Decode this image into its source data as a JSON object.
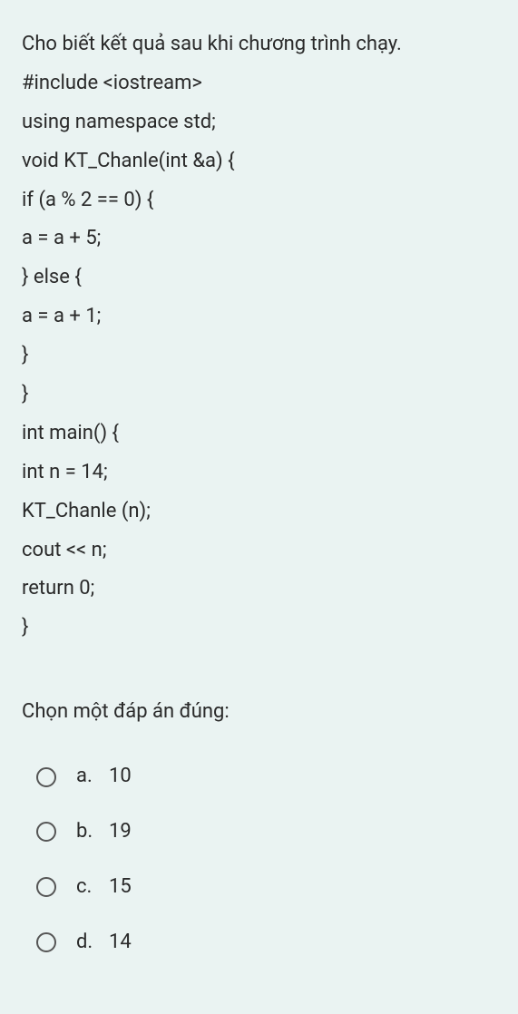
{
  "question": {
    "intro": "Cho biết kết quả sau khi chương trình chạy.",
    "code": [
      "#include <iostream>",
      "using namespace std;",
      "void KT_Chanle(int &a) {",
      "if (a % 2 == 0) {",
      "a = a + 5;",
      "} else {",
      "a = a + 1;",
      "}",
      "}",
      "int main() {",
      "int n = 14;",
      "KT_Chanle (n);",
      "cout << n;",
      "return 0;",
      "}"
    ]
  },
  "prompt": "Chọn một đáp án đúng:",
  "options": [
    {
      "letter": "a.",
      "value": "10"
    },
    {
      "letter": "b.",
      "value": "19"
    },
    {
      "letter": "c.",
      "value": "15"
    },
    {
      "letter": "d.",
      "value": "14"
    }
  ]
}
